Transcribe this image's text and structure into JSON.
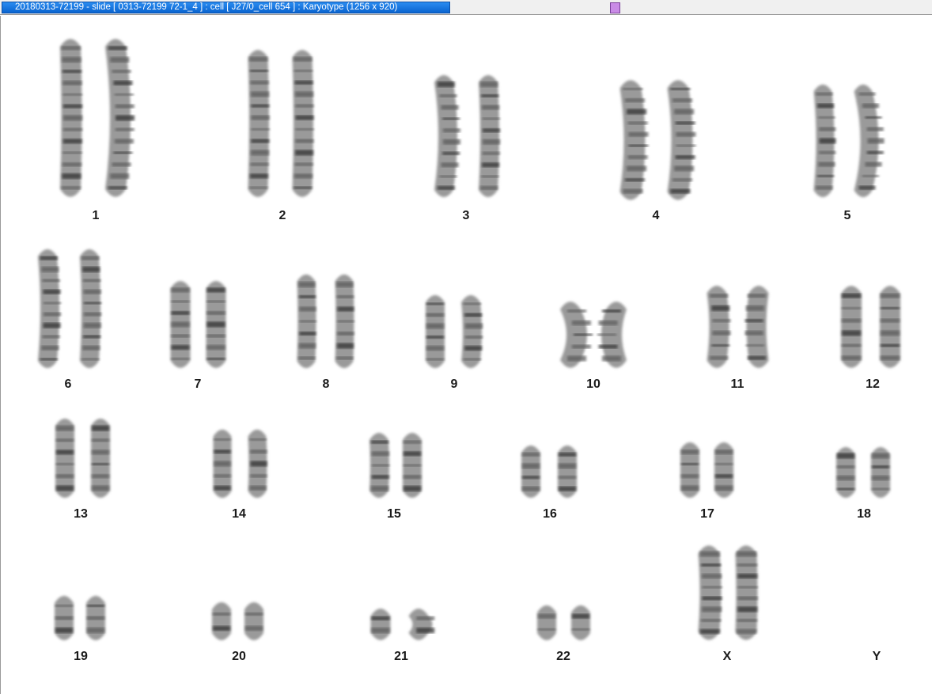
{
  "window": {
    "title": "20180313-72199 - slide [ 0313-72199 72-1_4 ] : cell [ J27/0_cell 654 ] : Karyotype  (1256 x 920)"
  },
  "karyotype": {
    "labels": {
      "c1": "1",
      "c2": "2",
      "c3": "3",
      "c4": "4",
      "c5": "5",
      "c6": "6",
      "c7": "7",
      "c8": "8",
      "c9": "9",
      "c10": "10",
      "c11": "11",
      "c12": "12",
      "c13": "13",
      "c14": "14",
      "c15": "15",
      "c16": "16",
      "c17": "17",
      "c18": "18",
      "c19": "19",
      "c20": "20",
      "c21": "21",
      "c22": "22",
      "cX": "X",
      "cY": "Y"
    }
  },
  "colors": {
    "title_bar": "#0a64d0",
    "marker": "#c98be6",
    "chromatid": "#8a8a8a"
  }
}
